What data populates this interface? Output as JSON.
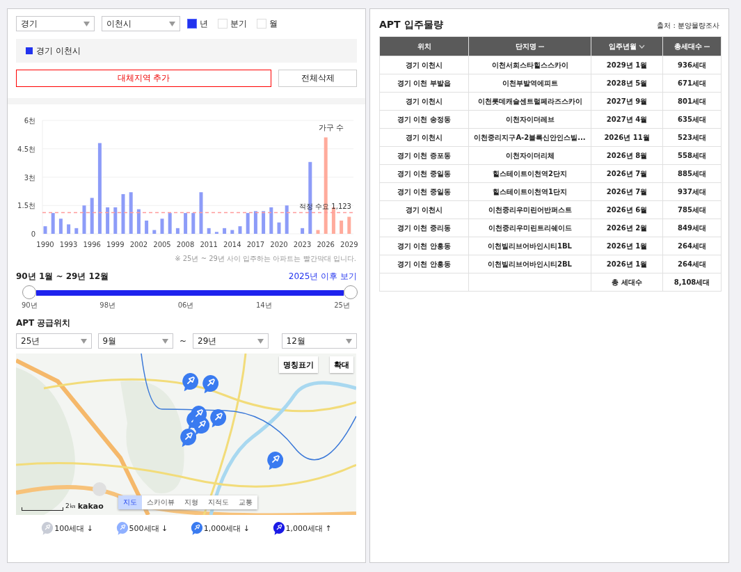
{
  "filters": {
    "province": "경기",
    "city": "이천시",
    "periods": [
      {
        "label": "년",
        "selected": true
      },
      {
        "label": "분기",
        "selected": false
      },
      {
        "label": "월",
        "selected": false
      }
    ]
  },
  "regions": [
    {
      "label": "경기 이천시",
      "color": "#2233ee"
    }
  ],
  "buttons": {
    "add": "대체지역 추가",
    "clear": "전체삭제"
  },
  "chart": {
    "note": "※ 25년 ~ 29년 사이 입주하는 아파트는 빨간막대 입니다.",
    "chart_data": {
      "type": "bar",
      "categories": [
        "1990",
        null,
        null,
        "1993",
        null,
        null,
        "1996",
        null,
        null,
        "1999",
        null,
        null,
        "2002",
        null,
        null,
        "2005",
        null,
        null,
        "2008",
        null,
        null,
        "2011",
        null,
        null,
        "2014",
        null,
        null,
        "2017",
        null,
        null,
        "2020",
        null,
        null,
        "2023",
        null,
        null,
        "2026",
        null,
        null,
        "2029"
      ],
      "ylabel": "가구 수",
      "grid": true,
      "series": [
        {
          "color": "#8d9cf8",
          "values": [
            0.4,
            1.1,
            0.8,
            0.5,
            0.3,
            1.5,
            1.9,
            4.8,
            1.4,
            1.4,
            2.1,
            2.2,
            1.3,
            0.7,
            0.2,
            0.8,
            1.1,
            0.3,
            1.1,
            1.1,
            2.2,
            0.3,
            0.1,
            0.3,
            0.2,
            0.4,
            1.1,
            1.2,
            1.2,
            1.4,
            0.6,
            1.5,
            null,
            0.3,
            3.8,
            null,
            null,
            null,
            null,
            null
          ]
        },
        {
          "color": "#ffab9c",
          "values": [
            null,
            null,
            null,
            null,
            null,
            null,
            null,
            null,
            null,
            null,
            null,
            null,
            null,
            null,
            null,
            null,
            null,
            null,
            null,
            null,
            null,
            null,
            null,
            null,
            null,
            null,
            null,
            null,
            null,
            null,
            null,
            null,
            null,
            null,
            null,
            0.2,
            5.1,
            1.4,
            0.7,
            0.9
          ]
        }
      ],
      "ylim": [
        0,
        6
      ],
      "yticks": [
        {
          "value": 0,
          "label": "0"
        },
        {
          "value": 1.5,
          "label": "1.5천"
        },
        {
          "value": 3,
          "label": "3천"
        },
        {
          "value": 4.5,
          "label": "4.5천"
        },
        {
          "value": 6,
          "label": "6천"
        }
      ],
      "ref_lines": [
        {
          "axis": "y",
          "value": 1.123,
          "label": "적정 수요 1,123"
        }
      ]
    }
  },
  "range": {
    "label": "90년 1월 ~ 29년 12월",
    "link": "2025년 이후 보기",
    "thumbs": [
      {
        "level": 0
      },
      {
        "level": 1
      }
    ],
    "ticks": [
      "90년",
      "98년",
      "06년",
      "14년",
      "25년"
    ]
  },
  "supply": {
    "title": "APT 공급위치",
    "from_year": "25년",
    "from_month": "9월",
    "separator": "~",
    "to_year": "29년",
    "to_month": "12월"
  },
  "map": {
    "kind": "picture",
    "buttons": [
      "명칭표기",
      "확대"
    ],
    "tabs": [
      {
        "label": "지도",
        "selected": true
      },
      {
        "label": "스카이뷰",
        "selected": false
      },
      {
        "label": "지형",
        "selected": false
      },
      {
        "label": "지적도",
        "selected": false
      },
      {
        "label": "교통",
        "selected": false
      }
    ],
    "scale": "2㎞",
    "logo": "kakao"
  },
  "legend": [
    {
      "label": "100세대 ↓",
      "color": "#c8ccd6"
    },
    {
      "label": "500세대 ↓",
      "color": "#8fb0ff"
    },
    {
      "label": "1,000세대 ↓",
      "color": "#3a7bf0"
    },
    {
      "label": "1,000세대 ↑",
      "color": "#1a1ae6"
    }
  ],
  "table": {
    "title": "APT 입주물량",
    "source": "출처 : 분양물량조사",
    "columns": [
      {
        "label": "위치"
      },
      {
        "label": "단지명",
        "sortable": true,
        "sorted": false
      },
      {
        "label": "입주년월",
        "sortable": true,
        "sorted": true
      },
      {
        "label": "총세대수",
        "sortable": true,
        "sorted": false
      }
    ],
    "rows": [
      [
        "경기 이천시",
        "이천서희스타힐스스카이",
        "2029년 1월",
        "936세대"
      ],
      [
        "경기 이천 부발읍",
        "이천부발역에피트",
        "2028년 5월",
        "671세대"
      ],
      [
        "경기 이천시",
        "이천롯데캐슬센트럴페라즈스카이",
        "2027년 9월",
        "801세대"
      ],
      [
        "경기 이천 송정동",
        "이천자이더레브",
        "2027년 4월",
        "635세대"
      ],
      [
        "경기 이천시",
        "이천중리지구A-2블록신안인스빌...",
        "2026년 11월",
        "523세대"
      ],
      [
        "경기 이천 증포동",
        "이천자이더리체",
        "2026년 8월",
        "558세대"
      ],
      [
        "경기 이천 중일동",
        "힐스테이트이천역2단지",
        "2026년 7월",
        "885세대"
      ],
      [
        "경기 이천 중일동",
        "힐스테이트이천역1단지",
        "2026년 7월",
        "937세대"
      ],
      [
        "경기 이천시",
        "이천중리우미린어반퍼스트",
        "2026년 6월",
        "785세대"
      ],
      [
        "경기 이천 중리동",
        "이천중리우미린트리쉐이드",
        "2026년 2월",
        "849세대"
      ],
      [
        "경기 이천 안흥동",
        "이천빌리브어바인시티1BL",
        "2026년 1월",
        "264세대"
      ],
      [
        "경기 이천 안흥동",
        "이천빌리브어바인시티2BL",
        "2026년 1월",
        "264세대"
      ]
    ],
    "footer": {
      "label": "총 세대수",
      "value": "8,108세대"
    }
  }
}
